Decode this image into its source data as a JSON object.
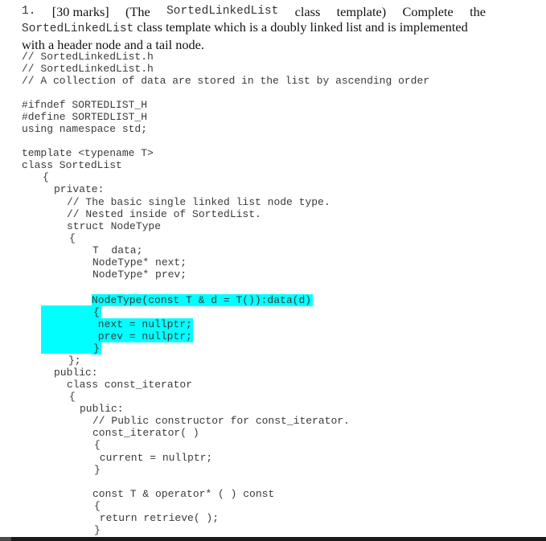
{
  "question": {
    "number": "1.",
    "marks": "[30 marks]",
    "line1_pre": "(The",
    "class_name": "SortedLinkedList",
    "line1_post_a": "class",
    "line1_post_b": "template)",
    "line1_post_c": "Complete",
    "line1_post_d": "the",
    "line2_class_name": "SortedLinkedList",
    "line2_text": " class template which is a doubly linked list and is implemented",
    "line3_text": "with a header node and a tail node."
  },
  "code": {
    "lines": [
      "// SortedLinkedList.h",
      "// SortedLinkedList.h",
      "// A collection of data are stored in the list by ascending order",
      "#ifndef SORTEDLIST_H",
      "#define SORTEDLIST_H",
      "using namespace std;",
      "template <typename T>",
      "class SortedList",
      "{",
      "private:",
      "// The basic single linked list node type.",
      "// Nested inside of SortedList.",
      "struct NodeType",
      "{",
      "T  data;",
      "NodeType* next;",
      "NodeType* prev;",
      "NodeType(const T & d = T()):data(d)",
      "{",
      " next = nullptr;",
      " prev = nullptr;",
      "}",
      "};",
      "public:",
      "class const_iterator",
      "{",
      "public:",
      "// Public constructor for const_iterator.",
      "const_iterator( )",
      "{",
      " current = nullptr;",
      "}",
      "const T & operator* ( ) const",
      "{",
      " return retrieve( );",
      "}"
    ]
  },
  "highlight": {
    "color": "#00ffff",
    "lines": [
      17,
      18,
      19,
      20,
      21
    ]
  }
}
